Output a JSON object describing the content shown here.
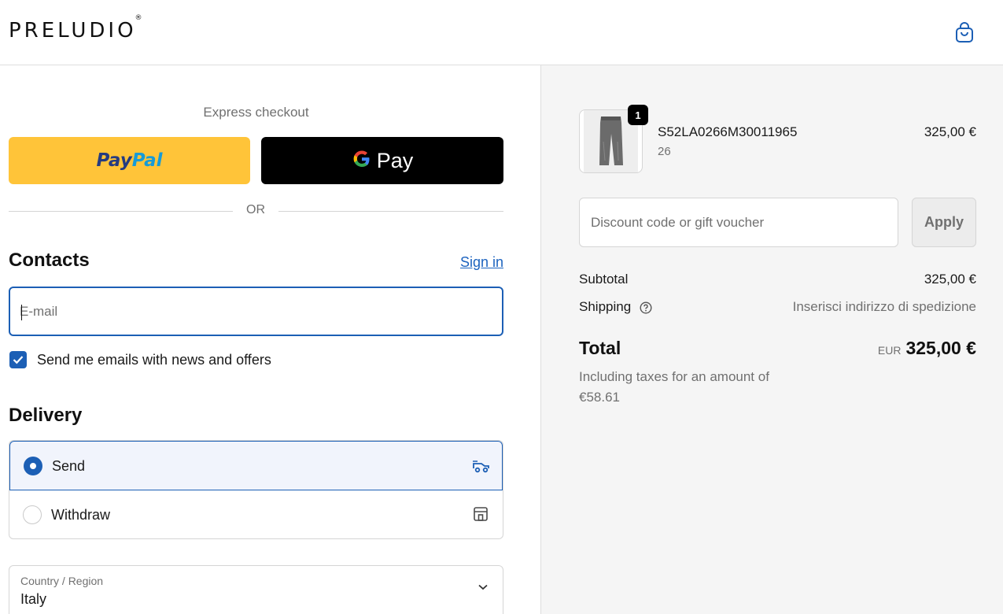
{
  "header": {
    "brand": "PRELUDIO",
    "brand_mark": "®",
    "cart_icon": "shopping-bag-icon"
  },
  "express": {
    "title": "Express checkout",
    "paypal_part1": "Pay",
    "paypal_part2": "Pal",
    "gpay_letter": "G",
    "gpay_label": "Pay",
    "divider": "OR"
  },
  "contacts": {
    "title": "Contacts",
    "signin": "Sign in",
    "email_placeholder": "E-mail",
    "email_value": "",
    "newsletter_label": "Send me emails with news and offers",
    "newsletter_checked": true
  },
  "delivery": {
    "title": "Delivery",
    "options": [
      {
        "label": "Send",
        "selected": true,
        "icon": "delivery-truck-icon"
      },
      {
        "label": "Withdraw",
        "selected": false,
        "icon": "store-icon"
      }
    ],
    "country_label": "Country / Region",
    "country_value": "Italy"
  },
  "summary": {
    "item": {
      "quantity": "1",
      "name": "S52LA0266M30011965",
      "variant": "26",
      "price": "325,00 €"
    },
    "discount_placeholder": "Discount code or gift voucher",
    "apply_label": "Apply",
    "subtotal_label": "Subtotal",
    "subtotal_value": "325,00 €",
    "shipping_label": "Shipping",
    "shipping_value": "Inserisci indirizzo di spedizione",
    "total_label": "Total",
    "total_currency": "EUR",
    "total_value": "325,00 €",
    "tax_note": "Including taxes for an amount of €58.61"
  },
  "colors": {
    "accent": "#1c5fb5",
    "paypal_yellow": "#ffc439",
    "summary_bg": "#f5f5f5"
  }
}
